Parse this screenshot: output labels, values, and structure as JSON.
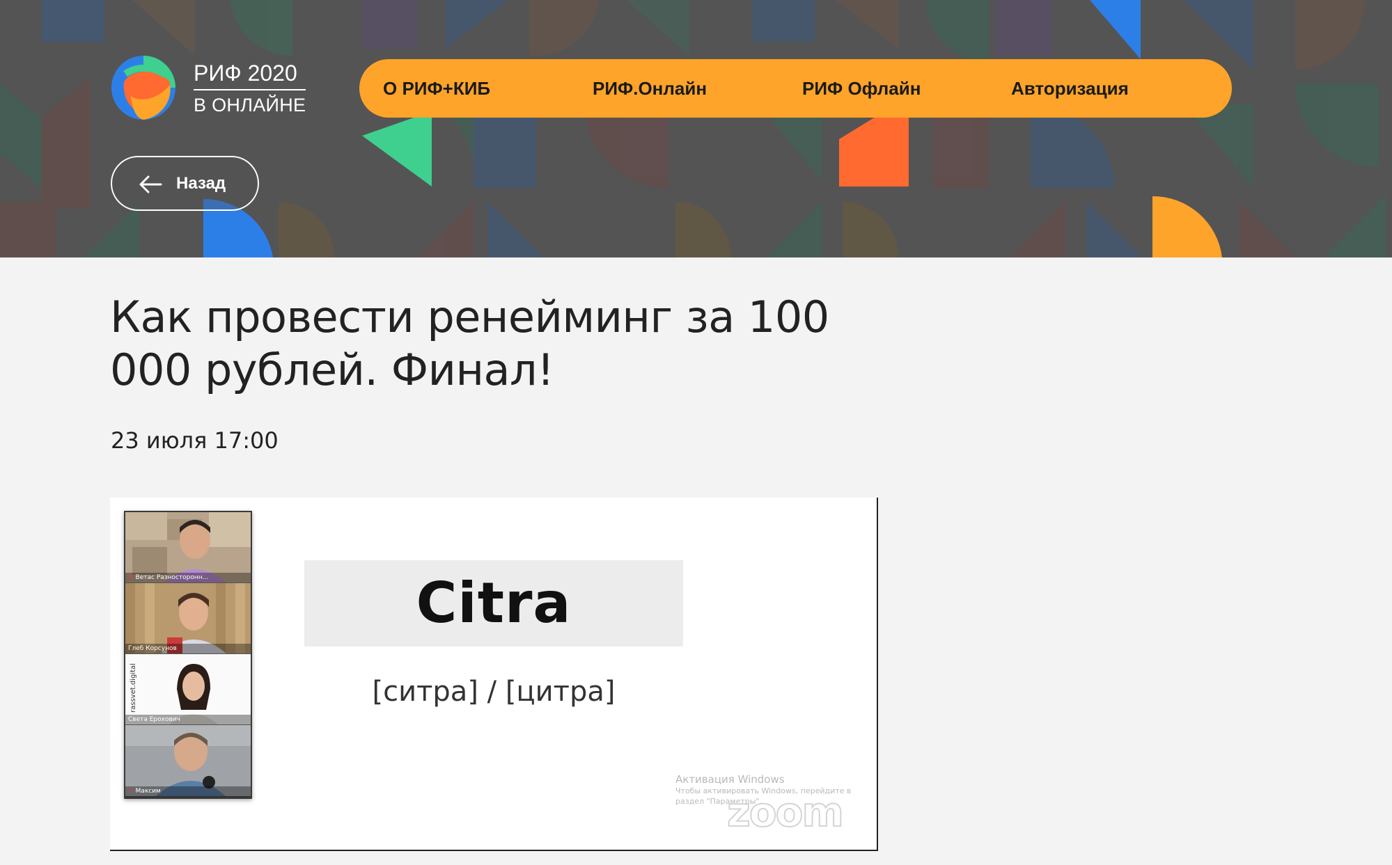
{
  "brand": {
    "line1": "РИФ 2020",
    "line2": "В ОНЛАЙНЕ",
    "colors": {
      "orange": "#ffa42a",
      "blue": "#2d7fe8",
      "green": "#3fcf8e",
      "red": "#ff6a30",
      "header_bg": "#545454"
    }
  },
  "nav": {
    "items": [
      {
        "label": "О РИФ+КИБ"
      },
      {
        "label": "РИФ.Онлайн"
      },
      {
        "label": "РИФ Офлайн"
      },
      {
        "label": "Авторизация"
      }
    ]
  },
  "back": {
    "label": "Назад",
    "icon": "arrow-left-icon"
  },
  "event": {
    "title": "Как провести ренейминг за 100 000 рублей. Финал!",
    "datetime": "23 июля 17:00"
  },
  "video": {
    "participants": [
      {
        "name": "Ветас Разносторонн..."
      },
      {
        "name": "Глеб Корсунов"
      },
      {
        "name": "Света Ерохович"
      },
      {
        "name": "Максим"
      }
    ],
    "side_text": "rassvet.digital",
    "slide": {
      "word": "Citra",
      "pronunciation": "[ситра] / [цитра]"
    },
    "watermark": {
      "title": "Активация Windows",
      "subtitle": "Чтобы активировать Windows, перейдите в раздел \"Параметры\".",
      "brand": "zoom"
    }
  }
}
